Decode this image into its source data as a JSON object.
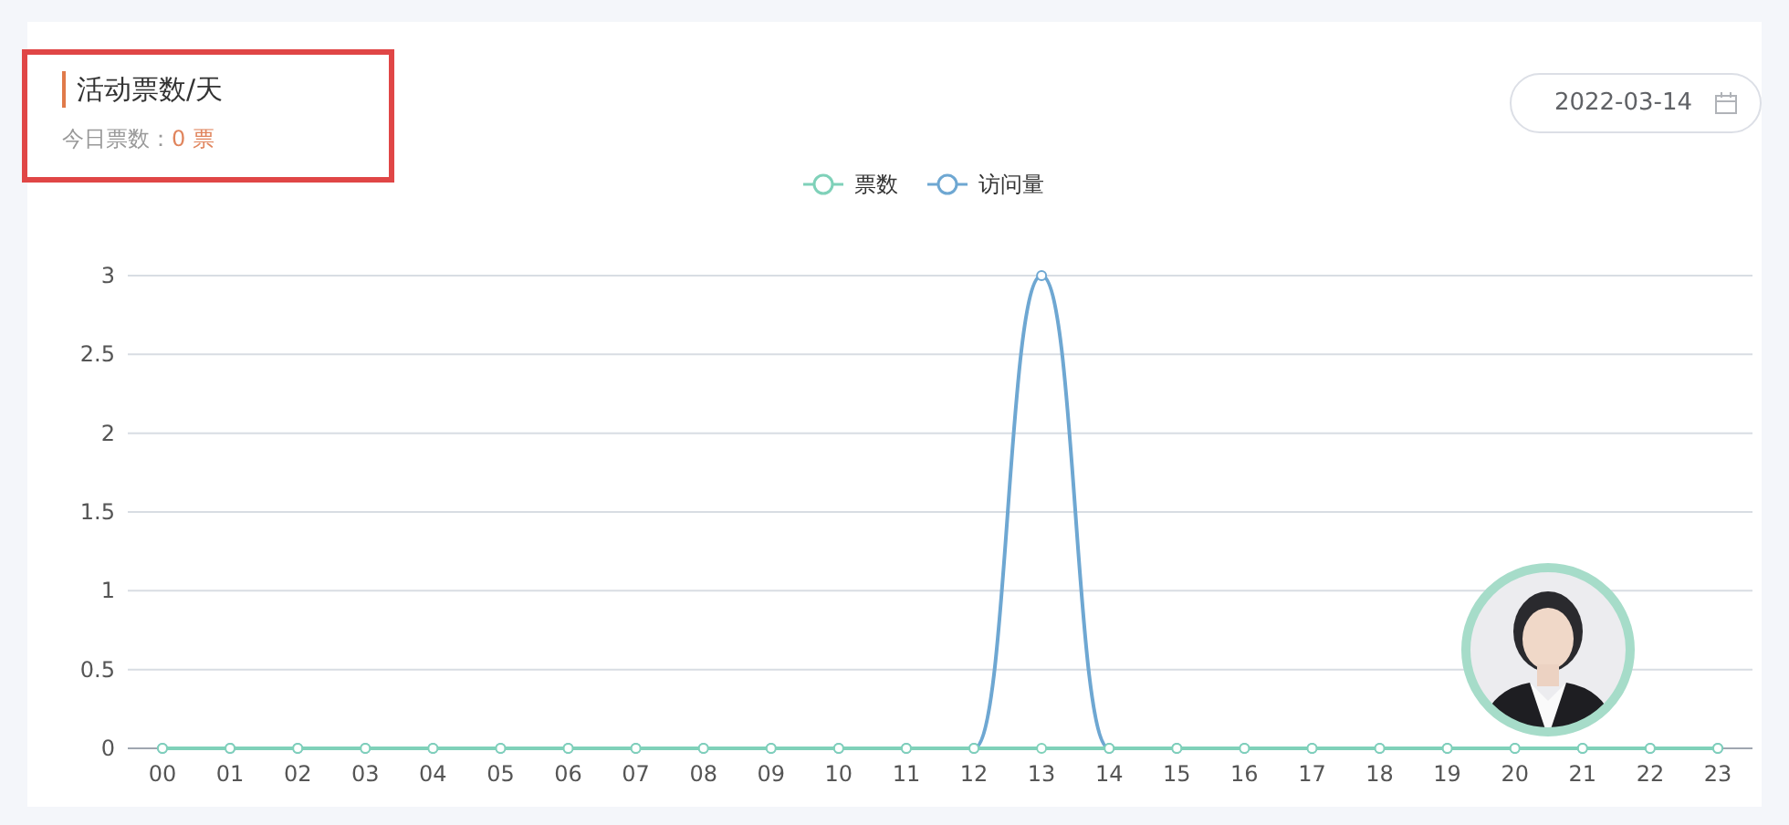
{
  "header": {
    "title": "活动票数/天",
    "subtitle_label": "今日票数：",
    "subtitle_value": "0 票"
  },
  "date_picker": {
    "value": "2022-03-14"
  },
  "chart": {
    "chart_data": {
      "type": "line",
      "categories": [
        "00",
        "01",
        "02",
        "03",
        "04",
        "05",
        "06",
        "07",
        "08",
        "09",
        "10",
        "11",
        "12",
        "13",
        "14",
        "15",
        "16",
        "17",
        "18",
        "19",
        "20",
        "21",
        "22",
        "23"
      ],
      "series": [
        {
          "name": "票数",
          "color": "#7fd1b9",
          "marker": "circle",
          "values": [
            0,
            0,
            0,
            0,
            0,
            0,
            0,
            0,
            0,
            0,
            0,
            0,
            0,
            0,
            0,
            0,
            0,
            0,
            0,
            0,
            0,
            0,
            0,
            0
          ]
        },
        {
          "name": "访问量",
          "color": "#6ea7d2",
          "marker": "circle",
          "values": [
            0,
            0,
            0,
            0,
            0,
            0,
            0,
            0,
            0,
            0,
            0,
            0,
            0,
            3,
            0,
            0,
            0,
            0,
            0,
            0,
            0,
            0,
            0,
            0
          ]
        }
      ],
      "grid": true,
      "legend": true,
      "ylim": [
        0,
        3
      ],
      "yticks": [
        0,
        0.5,
        1,
        1.5,
        2,
        2.5,
        3
      ]
    }
  }
}
